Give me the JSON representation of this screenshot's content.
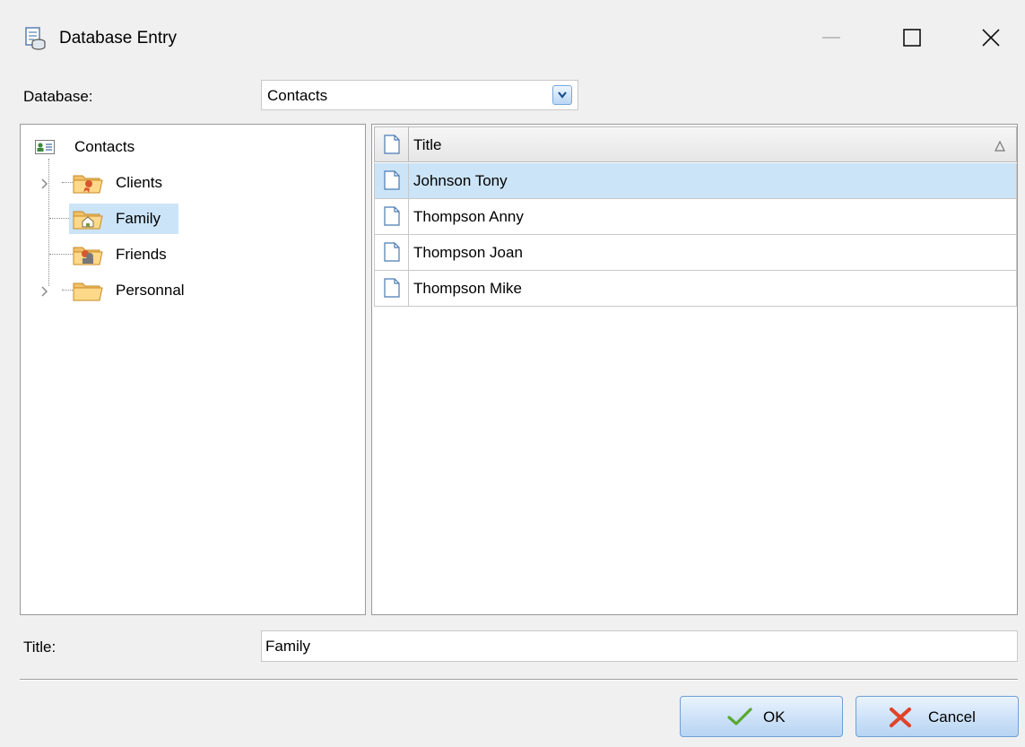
{
  "window": {
    "title": "Database Entry",
    "icon": "database-entry-icon",
    "controls": [
      "minimize-icon",
      "maximize-icon",
      "close-icon"
    ]
  },
  "database": {
    "label": "Database:",
    "selected": "Contacts"
  },
  "tree": {
    "root": {
      "label": "Contacts",
      "icon": "contacts-card-icon"
    },
    "items": [
      {
        "label": "Clients",
        "icon": "folder-clients-icon",
        "expandable": true,
        "selected": false
      },
      {
        "label": "Family",
        "icon": "folder-family-icon",
        "expandable": false,
        "selected": true
      },
      {
        "label": "Friends",
        "icon": "folder-friends-icon",
        "expandable": false,
        "selected": false
      },
      {
        "label": "Personnal",
        "icon": "folder-icon",
        "expandable": true,
        "selected": false
      }
    ]
  },
  "list": {
    "column_header": "Title",
    "sort": "ascending",
    "rows": [
      {
        "title": "Johnson Tony",
        "selected": true
      },
      {
        "title": "Thompson Anny",
        "selected": false
      },
      {
        "title": "Thompson Joan",
        "selected": false
      },
      {
        "title": "Thompson Mike",
        "selected": false
      }
    ]
  },
  "title_field": {
    "label": "Title:",
    "value": "Family"
  },
  "buttons": {
    "ok_label": "OK",
    "cancel_label": "Cancel"
  },
  "colors": {
    "selection": "#cce4f7",
    "button_border": "#6f9fd4",
    "ok_check": "#5aa832",
    "cancel_x": "#e0442a"
  }
}
